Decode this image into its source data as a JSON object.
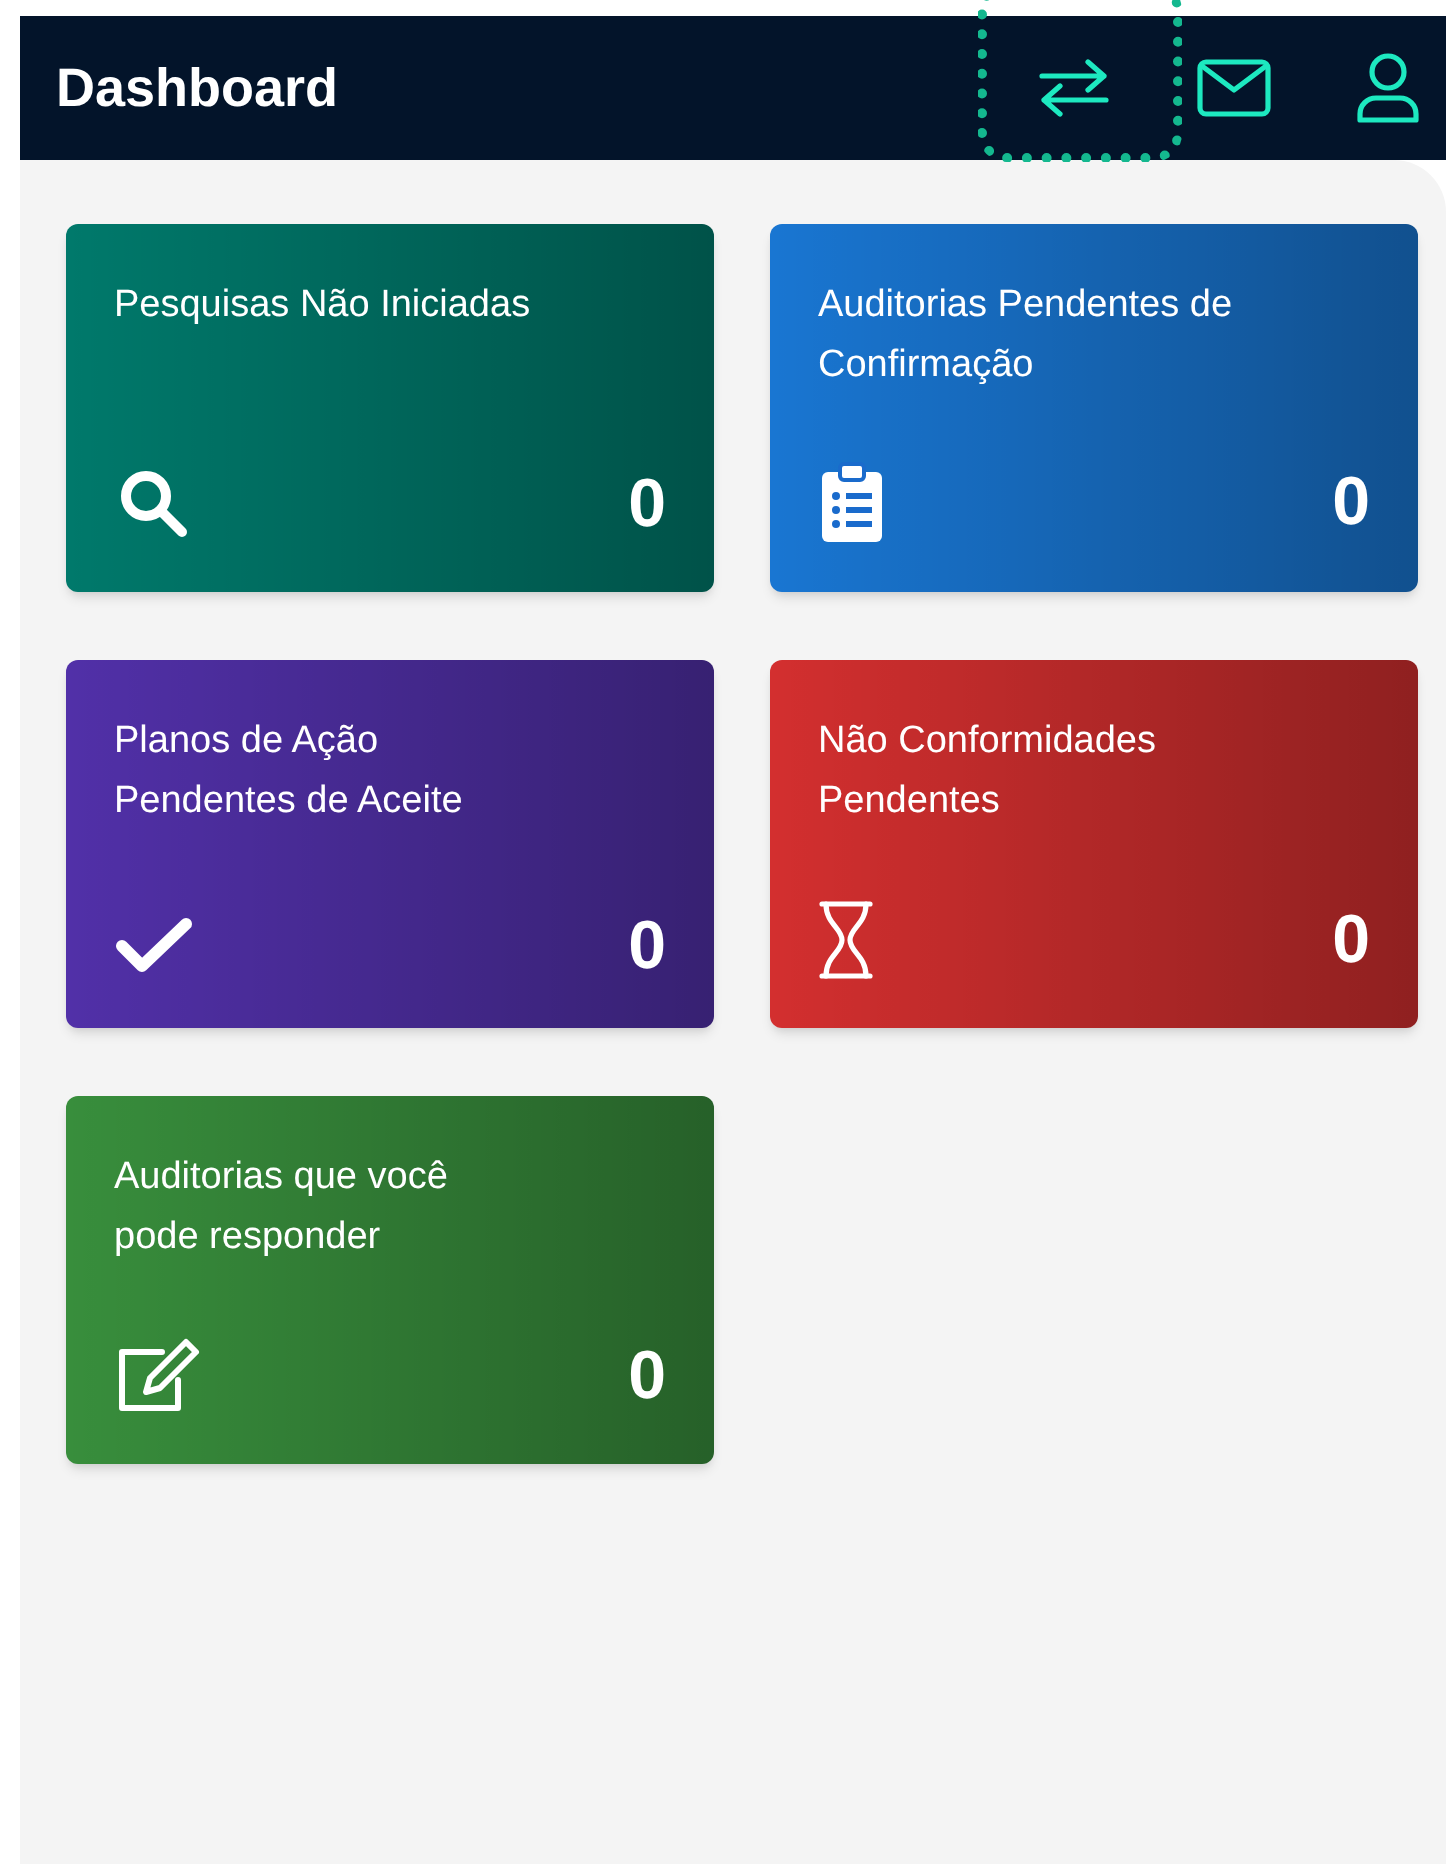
{
  "header": {
    "title": "Dashboard",
    "buttons": [
      {
        "kind": "swap",
        "focused": true
      },
      {
        "kind": "mail",
        "focused": false
      },
      {
        "kind": "user",
        "focused": false
      }
    ]
  },
  "cards": [
    {
      "title": "Pesquisas Não Iniciadas",
      "count": "0",
      "kind": "search",
      "color": "#00796b"
    },
    {
      "title": "Auditorias Pendentes de Confirmação",
      "count": "0",
      "kind": "clipboard",
      "color": "#1976d2"
    },
    {
      "title": "Planos de Ação Pendentes de Aceite",
      "count": "0",
      "kind": "check",
      "color": "#5130a8"
    },
    {
      "title": "Não Conformidades Pendentes",
      "count": "0",
      "kind": "hourglass",
      "color": "#d32f2f"
    },
    {
      "title": "Auditorias que você pode responder",
      "count": "0",
      "kind": "edit",
      "color": "#388e3c"
    }
  ]
}
